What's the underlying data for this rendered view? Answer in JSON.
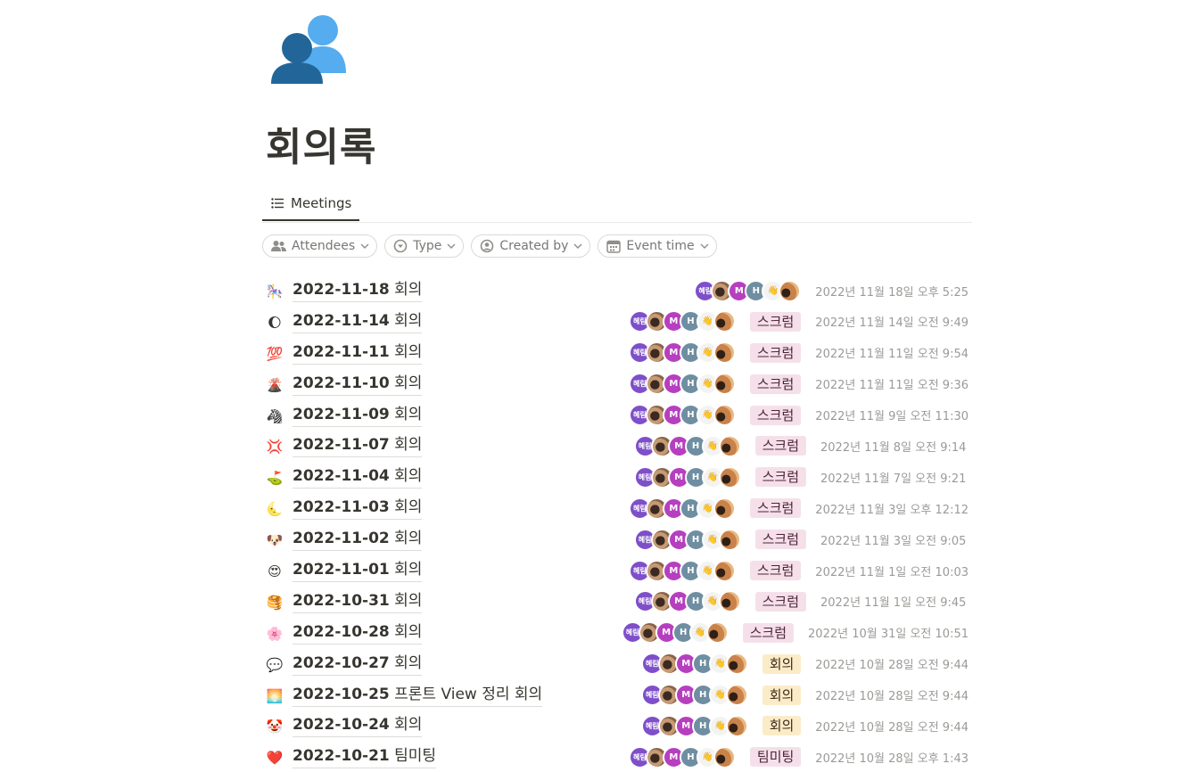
{
  "page": {
    "icon": "busts-in-silhouette-icon",
    "title": "회의록"
  },
  "tabs": [
    {
      "label": "Meetings",
      "icon": "list-icon"
    }
  ],
  "filters": [
    {
      "label": "Attendees",
      "icon": "people-icon"
    },
    {
      "label": "Type",
      "icon": "circle-chevron-icon"
    },
    {
      "label": "Created by",
      "icon": "user-circle-icon"
    },
    {
      "label": "Event time",
      "icon": "calendar-icon"
    }
  ],
  "avatar_labels": {
    "hyerim": "혜림",
    "m": "M",
    "h": "H"
  },
  "meetings": [
    {
      "emoji": "🎠",
      "date_label": "2022-11-18",
      "suffix": "회의",
      "tag": "",
      "created": "2022년 11월 18일 오후 5:25"
    },
    {
      "emoji": "🌔",
      "date_label": "2022-11-14",
      "suffix": "회의",
      "tag": "스크럼",
      "created": "2022년 11월 14일 오전 9:49"
    },
    {
      "emoji": "💯",
      "date_label": "2022-11-11",
      "suffix": "회의",
      "tag": "스크럼",
      "created": "2022년 11월 11일 오전 9:54"
    },
    {
      "emoji": "🌋",
      "date_label": "2022-11-10",
      "suffix": "회의",
      "tag": "스크럼",
      "created": "2022년 11월 11일 오전 9:36"
    },
    {
      "emoji": "🦓",
      "date_label": "2022-11-09",
      "suffix": "회의",
      "tag": "스크럼",
      "created": "2022년 11월 9일 오전 11:30"
    },
    {
      "emoji": "💢",
      "date_label": "2022-11-07",
      "suffix": "회의",
      "tag": "스크럼",
      "created": "2022년 11월 8일 오전 9:14"
    },
    {
      "emoji": "⛳",
      "date_label": "2022-11-04",
      "suffix": "회의",
      "tag": "스크럼",
      "created": "2022년 11월 7일 오전 9:21"
    },
    {
      "emoji": "🌜",
      "date_label": "2022-11-03",
      "suffix": "회의",
      "tag": "스크럼",
      "created": "2022년 11월 3일 오후 12:12"
    },
    {
      "emoji": "🐶",
      "date_label": "2022-11-02",
      "suffix": "회의",
      "tag": "스크럼",
      "created": "2022년 11월 3일 오전 9:05"
    },
    {
      "emoji": "😍",
      "date_label": "2022-11-01",
      "suffix": "회의",
      "tag": "스크럼",
      "created": "2022년 11월 1일 오전 10:03"
    },
    {
      "emoji": "🥞",
      "date_label": "2022-10-31",
      "suffix": "회의",
      "tag": "스크럼",
      "created": "2022년 11월 1일 오전 9:45"
    },
    {
      "emoji": "🌸",
      "date_label": "2022-10-28",
      "suffix": "회의",
      "tag": "스크럼",
      "created": "2022년 10월 31일 오전 10:51"
    },
    {
      "emoji": "💬",
      "date_label": "2022-10-27",
      "suffix": "회의",
      "tag": "회의",
      "created": "2022년 10월 28일 오전 9:44"
    },
    {
      "emoji": "🌅",
      "date_label": "2022-10-25",
      "suffix": "프론트 View 정리 회의",
      "tag": "회의",
      "created": "2022년 10월 28일 오전 9:44"
    },
    {
      "emoji": "🤡",
      "date_label": "2022-10-24",
      "suffix": "회의",
      "tag": "회의",
      "created": "2022년 10월 28일 오전 9:44"
    },
    {
      "emoji": "❤️",
      "date_label": "2022-10-21",
      "suffix": "팀미팅",
      "tag": "팀미팅",
      "created": "2022년 10월 28일 오후 1:43"
    }
  ]
}
